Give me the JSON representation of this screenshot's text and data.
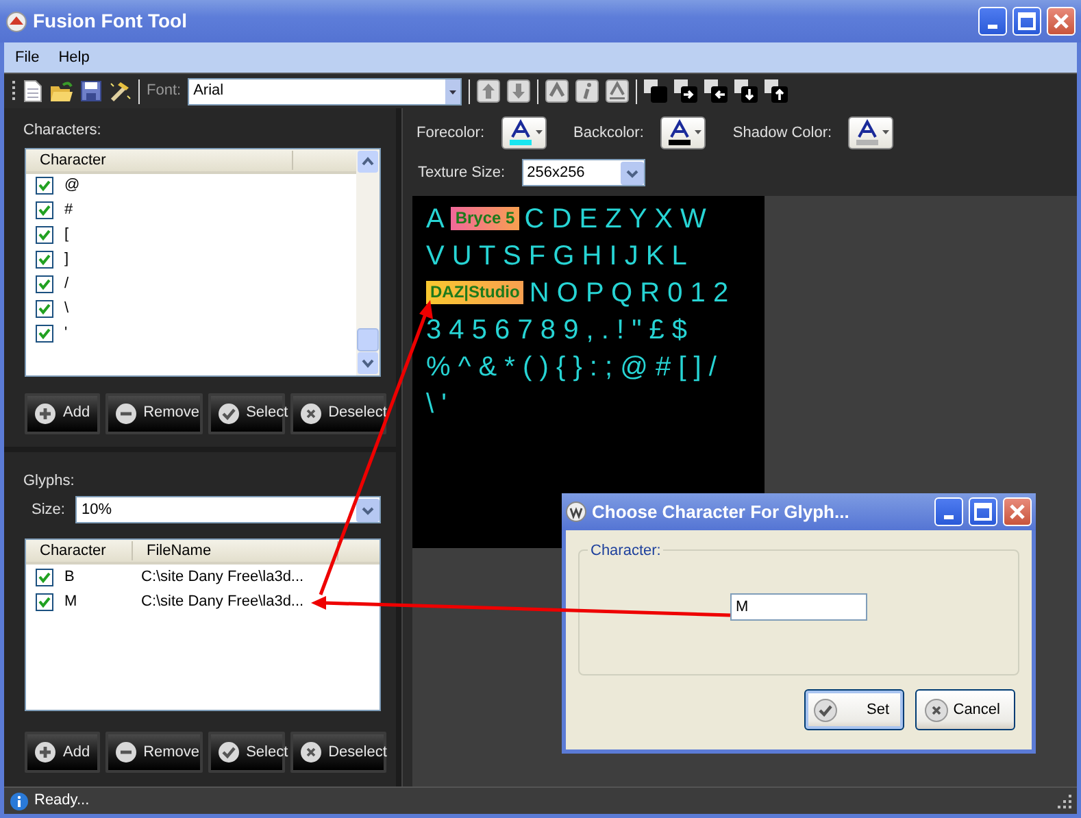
{
  "window": {
    "title": "Fusion Font Tool"
  },
  "menu": [
    {
      "label": "File"
    },
    {
      "label": "Help"
    }
  ],
  "toolbar": {
    "font_label": "Font:",
    "font_value": "Arial"
  },
  "characters": {
    "label": "Characters:",
    "columns": [
      "Character"
    ],
    "rows": [
      {
        "character": "@",
        "checked": true
      },
      {
        "character": "#",
        "checked": true
      },
      {
        "character": "[",
        "checked": true
      },
      {
        "character": "]",
        "checked": true
      },
      {
        "character": "/",
        "checked": true
      },
      {
        "character": "\\",
        "checked": true
      },
      {
        "character": "'",
        "checked": true
      }
    ],
    "buttons": [
      {
        "kind": "add",
        "label": "Add"
      },
      {
        "kind": "remove",
        "label": "Remove"
      },
      {
        "kind": "select",
        "label": "Select"
      },
      {
        "kind": "deselect",
        "label": "Deselect"
      }
    ]
  },
  "glyphs": {
    "label": "Glyphs:",
    "size_label": "Size:",
    "size_value": "10%",
    "columns": [
      "Character",
      "FileName"
    ],
    "rows": [
      {
        "character": "B",
        "filename": "C:\\site Dany Free\\la3d...",
        "checked": true
      },
      {
        "character": "M",
        "filename": "C:\\site Dany Free\\la3d...",
        "checked": true
      }
    ],
    "buttons": [
      {
        "kind": "add",
        "label": "Add"
      },
      {
        "kind": "remove",
        "label": "Remove"
      },
      {
        "kind": "select",
        "label": "Select"
      },
      {
        "kind": "deselect",
        "label": "Deselect"
      }
    ]
  },
  "colors": [
    {
      "label": "Forecolor:",
      "color": "#19e6f0"
    },
    {
      "label": "Backcolor:",
      "color": "#000000"
    },
    {
      "label": "Shadow Color:",
      "color": "#b4b4b4"
    }
  ],
  "texture_size": {
    "label": "Texture Size:",
    "value": "256x256"
  },
  "texture": [
    [
      {
        "kind": "chars",
        "text": "A"
      },
      {
        "kind": "logo",
        "text": "Bryce 5",
        "color": "#f0689a"
      },
      {
        "kind": "chars",
        "text": "C D E Z Y X W"
      }
    ],
    [
      {
        "kind": "chars",
        "text": "V U T S F G H I J K L"
      }
    ],
    [
      {
        "kind": "logo",
        "text": "DAZ|Studio",
        "color": "#f8c830"
      },
      {
        "kind": "chars",
        "text": "N O P Q R 0 1 2"
      }
    ],
    [
      {
        "kind": "chars",
        "text": "3 4 5 6 7 8 9 , . ! \" £ $"
      }
    ],
    [
      {
        "kind": "chars",
        "text": "% ^ & * ( ) { } : ; @ # [ ] /"
      }
    ],
    [
      {
        "kind": "chars",
        "text": "\\ '"
      }
    ]
  ],
  "dialog": {
    "title": "Choose Character For Glyph...",
    "group_label": "Character:",
    "value": "M",
    "buttons": [
      {
        "kind": "ok",
        "label": "Set"
      },
      {
        "kind": "cancel",
        "label": "Cancel"
      }
    ]
  },
  "status_bar": {
    "text": "Ready..."
  }
}
